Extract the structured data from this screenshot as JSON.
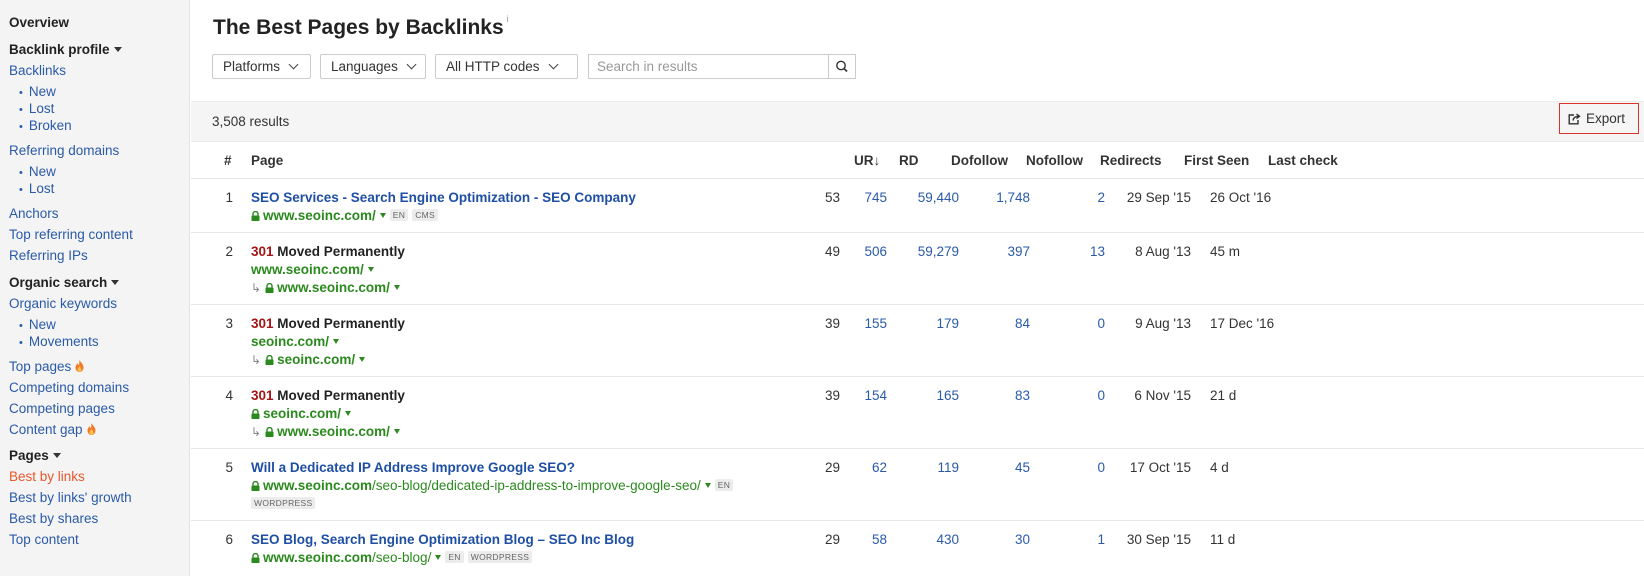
{
  "sidebar": {
    "overview": "Overview",
    "backlink_profile": "Backlink profile",
    "backlinks": "Backlinks",
    "backlinks_sub": [
      "New",
      "Lost",
      "Broken"
    ],
    "referring_domains": "Referring domains",
    "referring_domains_sub": [
      "New",
      "Lost"
    ],
    "anchors": "Anchors",
    "top_referring_content": "Top referring content",
    "referring_ips": "Referring IPs",
    "organic_search": "Organic search",
    "organic_keywords": "Organic keywords",
    "organic_sub": [
      "New",
      "Movements"
    ],
    "top_pages": "Top pages",
    "competing_domains": "Competing domains",
    "competing_pages": "Competing pages",
    "content_gap": "Content gap",
    "pages": "Pages",
    "best_by_links": "Best by links",
    "best_by_links_growth": "Best by links' growth",
    "best_by_shares": "Best by shares",
    "top_content": "Top content",
    "bullet": "•"
  },
  "header": {
    "title": "The Best Pages by Backlinks",
    "info_mark": "i"
  },
  "filters": {
    "platforms": "Platforms",
    "languages": "Languages",
    "http_codes": "All HTTP codes",
    "search_placeholder": "Search in results"
  },
  "results": {
    "count": "3,508 results",
    "export": "Export"
  },
  "table": {
    "columns": {
      "index": "#",
      "page": "Page",
      "ur": "UR",
      "ur_sort": "↓",
      "rd": "RD",
      "dofollow": "Dofollow",
      "nofollow": "Nofollow",
      "redirects": "Redirects",
      "first_seen": "First Seen",
      "last_check": "Last check"
    },
    "redirect_arrow": "↳",
    "rows": [
      {
        "index": "1",
        "code": "",
        "title": "SEO Services - Search Engine Optimization - SEO Company",
        "url_domain": "www.seoinc.com/",
        "url_path": "",
        "tag1": "EN",
        "tag2": "CMS",
        "redirect_domain": "",
        "ur": "53",
        "rd": "745",
        "dofollow": "59,440",
        "nofollow": "1,748",
        "redirects": "2",
        "first_seen": "29 Sep '15",
        "last_check": "26 Oct '16"
      },
      {
        "index": "2",
        "code": "301",
        "title": "Moved Permanently",
        "url_domain": "www.seoinc.com/",
        "url_path": "",
        "tag1": "",
        "tag2": "",
        "redirect_domain": "www.seoinc.com/",
        "ur": "49",
        "rd": "506",
        "dofollow": "59,279",
        "nofollow": "397",
        "redirects": "13",
        "first_seen": "8 Aug '13",
        "last_check": "45 m"
      },
      {
        "index": "3",
        "code": "301",
        "title": "Moved Permanently",
        "url_domain": "seoinc.com/",
        "url_path": "",
        "tag1": "",
        "tag2": "",
        "redirect_domain": "seoinc.com/",
        "ur": "39",
        "rd": "155",
        "dofollow": "179",
        "nofollow": "84",
        "redirects": "0",
        "first_seen": "9 Aug '13",
        "last_check": "17 Dec '16"
      },
      {
        "index": "4",
        "code": "301",
        "title": "Moved Permanently",
        "url_domain": "seoinc.com/",
        "url_path": "",
        "tag1": "",
        "tag2": "",
        "redirect_domain": "www.seoinc.com/",
        "ur": "39",
        "rd": "154",
        "dofollow": "165",
        "nofollow": "83",
        "redirects": "0",
        "first_seen": "6 Nov '15",
        "last_check": "21 d"
      },
      {
        "index": "5",
        "code": "",
        "title": "Will a Dedicated IP Address Improve Google SEO?",
        "url_domain": "www.seoinc.com",
        "url_path": "/seo-blog/dedicated-ip-address-to-improve-google-seo/",
        "tag1": "EN",
        "tag2": "WORDPRESS",
        "redirect_domain": "",
        "ur": "29",
        "rd": "62",
        "dofollow": "119",
        "nofollow": "45",
        "redirects": "0",
        "first_seen": "17 Oct '15",
        "last_check": "4 d"
      },
      {
        "index": "6",
        "code": "",
        "title": "SEO Blog, Search Engine Optimization Blog – SEO Inc Blog",
        "url_domain": "www.seoinc.com",
        "url_path": "/seo-blog/",
        "tag1": "EN",
        "tag2": "WORDPRESS",
        "redirect_domain": "",
        "ur": "29",
        "rd": "58",
        "dofollow": "430",
        "nofollow": "30",
        "redirects": "1",
        "first_seen": "30 Sep '15",
        "last_check": "11 d"
      }
    ]
  },
  "colors": {
    "link": "#2a5aa8",
    "active": "#e8572c",
    "url_green": "#2b8a1e",
    "http_code_red": "#a31515",
    "export_border": "#d9352b"
  }
}
